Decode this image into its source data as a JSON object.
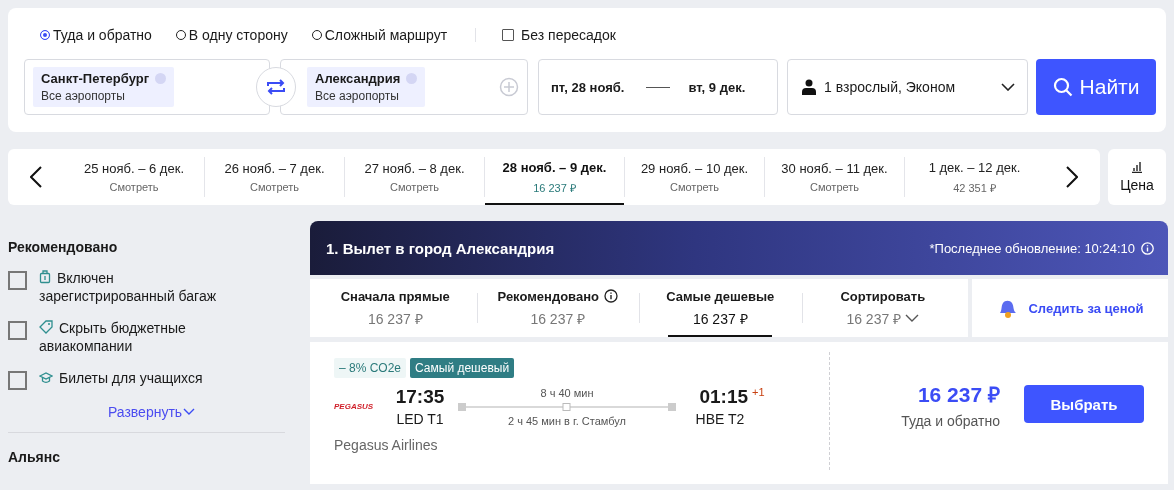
{
  "search": {
    "trip_types": [
      {
        "label": "Туда и обратно",
        "selected": true
      },
      {
        "label": "В одну сторону",
        "selected": false
      },
      {
        "label": "Сложный маршрут",
        "selected": false
      }
    ],
    "nonstop": {
      "label": "Без пересадок",
      "checked": false
    },
    "from": {
      "city": "Санкт-Петербург",
      "airports": "Все аэропорты"
    },
    "to": {
      "city": "Александрия",
      "airports": "Все аэропорты"
    },
    "dates": {
      "depart": "пт, 28 нояб.",
      "return": "вт, 9 дек."
    },
    "passengers": "1 взрослый, Эконом",
    "search_button": "Найти"
  },
  "date_strip": {
    "items": [
      {
        "dates": "25 нояб. – 6 дек.",
        "price": "Смотреть",
        "selected": false
      },
      {
        "dates": "26 нояб. – 7 дек.",
        "price": "Смотреть",
        "selected": false
      },
      {
        "dates": "27 нояб. – 8 дек.",
        "price": "Смотреть",
        "selected": false
      },
      {
        "dates": "28 нояб. – 9 дек.",
        "price": "16 237 ₽",
        "selected": true
      },
      {
        "dates": "29 нояб. – 10 дек.",
        "price": "Смотреть",
        "selected": false
      },
      {
        "dates": "30 нояб. – 11 дек.",
        "price": "Смотреть",
        "selected": false
      },
      {
        "dates": "1 дек. – 12 дек.",
        "price": "42 351 ₽",
        "selected": false
      }
    ],
    "price_toggle": "Цена"
  },
  "filters": {
    "title": "Рекомендовано",
    "items": [
      {
        "kind": "baggage",
        "label": "Включен зарегистрированный багаж",
        "checked": false
      },
      {
        "kind": "tag",
        "label": "Скрыть бюджетные авиакомпании",
        "checked": false
      },
      {
        "kind": "student",
        "label": "Билеты для учащихся",
        "checked": false
      }
    ],
    "expand": "Развернуть",
    "next_section": "Альянс"
  },
  "results": {
    "title": "1. Вылет в город Александрия",
    "updated": "*Последнее обновление: 10:24:10",
    "sort_tabs": [
      {
        "kind": "plain",
        "label": "Сначала прямые",
        "price": "16 237 ₽",
        "selected": false
      },
      {
        "kind": "info",
        "label": "Рекомендовано",
        "price": "16 237 ₽",
        "selected": false
      },
      {
        "kind": "plain",
        "label": "Самые дешевые",
        "price": "16 237 ₽",
        "selected": true
      },
      {
        "kind": "dropdown",
        "label": "Сортировать",
        "price": "16 237 ₽",
        "selected": false
      }
    ],
    "watch_price": "Следить за ценой",
    "ticket": {
      "badges": [
        {
          "kind": "eco",
          "text": "– 8% CO2e"
        },
        {
          "kind": "cheapest",
          "text": "Самый дешевый"
        }
      ],
      "airline_logo": "PEGASUS",
      "depart_time": "17:35",
      "depart_airport": "LED T1",
      "duration": "8 ч 40 мин",
      "layover": "2 ч 45 мин в г. Стамбул",
      "arrive_time": "01:15",
      "day_offset": "+1",
      "arrive_airport": "HBE T2",
      "airline": "Pegasus Airlines",
      "price": "16 237 ₽",
      "price_note": "Туда и обратно",
      "select_button": "Выбрать"
    }
  }
}
